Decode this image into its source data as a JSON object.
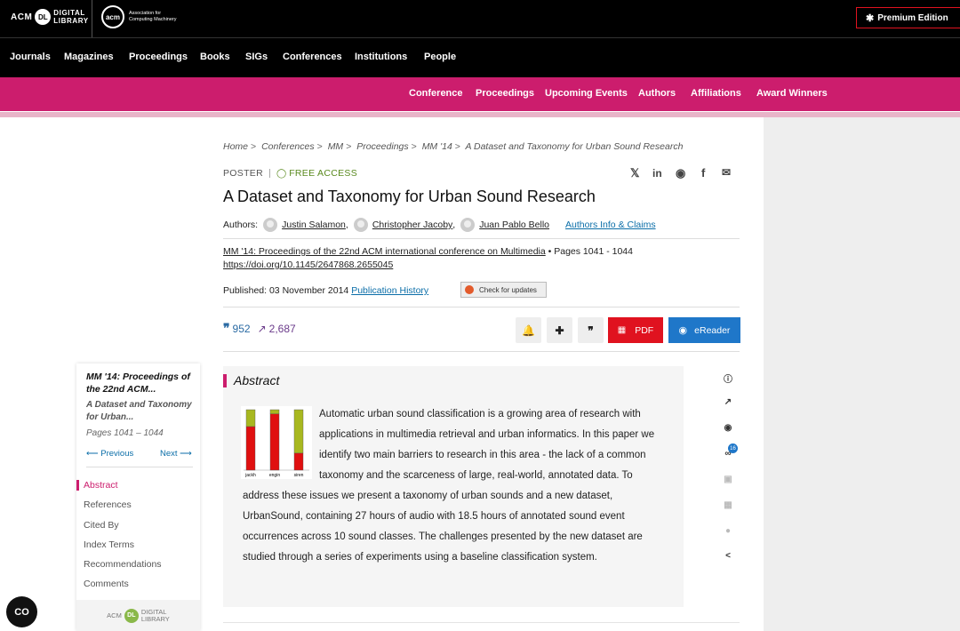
{
  "header": {
    "acm_logo": {
      "acm": "ACM",
      "dl": "DL",
      "line1": "DIGITAL",
      "line2": "LIBRARY"
    },
    "assoc_logo": {
      "mark": "acm",
      "line1": "Association for",
      "line2": "Computing Machinery"
    },
    "premium_label": "Premium Edition"
  },
  "main_nav": [
    "Journals",
    "Magazines",
    "Proceedings",
    "Books",
    "SIGs",
    "Conferences",
    "Institutions",
    "People"
  ],
  "conf_nav": [
    "Conference",
    "Proceedings",
    "Upcoming Events",
    "Authors",
    "Affiliations",
    "Award Winners"
  ],
  "breadcrumb": [
    "Home",
    "Conferences",
    "MM",
    "Proceedings",
    "MM '14",
    "A Dataset and Taxonomy for Urban Sound Research"
  ],
  "article": {
    "type": "POSTER",
    "access": "FREE ACCESS",
    "title": "A Dataset and Taxonomy for Urban Sound Research",
    "authors_label": "Authors:",
    "authors": [
      "Justin Salamon",
      "Christopher Jacoby",
      "Juan Pablo Bello"
    ],
    "authors_link": "Authors Info & Claims",
    "proceedings": "MM '14: Proceedings of the 22nd ACM international conference on Multimedia",
    "pages": "Pages 1041 - 1044",
    "doi": "https://doi.org/10.1145/2647868.2655045",
    "published_label": "Published:",
    "published_date": "03 November 2014",
    "history_link": "Publication History",
    "check_updates": "Check for updates",
    "citations": "952",
    "downloads": "2,687",
    "pdf_label": "PDF",
    "ereader_label": "eReader"
  },
  "share_icons": [
    "x-icon",
    "linkedin-icon",
    "reddit-icon",
    "facebook-icon",
    "email-icon"
  ],
  "sidebar": {
    "title": "MM '14: Proceedings of the 22nd ACM...",
    "subtitle": "A Dataset and Taxonomy for Urban...",
    "pages": "Pages 1041 – 1044",
    "prev": "Previous",
    "next": "Next",
    "items": [
      "Abstract",
      "References",
      "Cited By",
      "Index Terms",
      "Recommendations",
      "Comments"
    ],
    "footer": {
      "acm": "ACM",
      "dl": "DL",
      "line1": "DIGITAL",
      "line2": "LIBRARY"
    }
  },
  "abstract": {
    "heading": "Abstract",
    "text": "Automatic urban sound classification is a growing area of research with applications in multimedia retrieval and urban informatics. In this paper we identify two main barriers to research in this area - the lack of a common taxonomy and the scarceness of large, real-world, annotated data. To address these issues we present a taxonomy of urban sounds and a new dataset, UrbanSound, containing 27 hours of audio with 18.5 hours of annotated sound event occurrences across 10 sound classes. The challenges presented by the new dataset are studied through a series of experiments using a baseline classification system.",
    "figure_labels": [
      "jackh",
      "engin",
      "siren"
    ],
    "figure_values": [
      {
        "red": 0.72,
        "green": 0.28
      },
      {
        "red": 0.93,
        "green": 0.07
      },
      {
        "red": 0.28,
        "green": 0.72
      }
    ]
  },
  "tools": {
    "badge": "16"
  },
  "colors": {
    "accent_pink": "#cc1d6d",
    "pdf_red": "#e0121f",
    "ereader_blue": "#1f77c9",
    "free_green": "#5a8a1f"
  }
}
